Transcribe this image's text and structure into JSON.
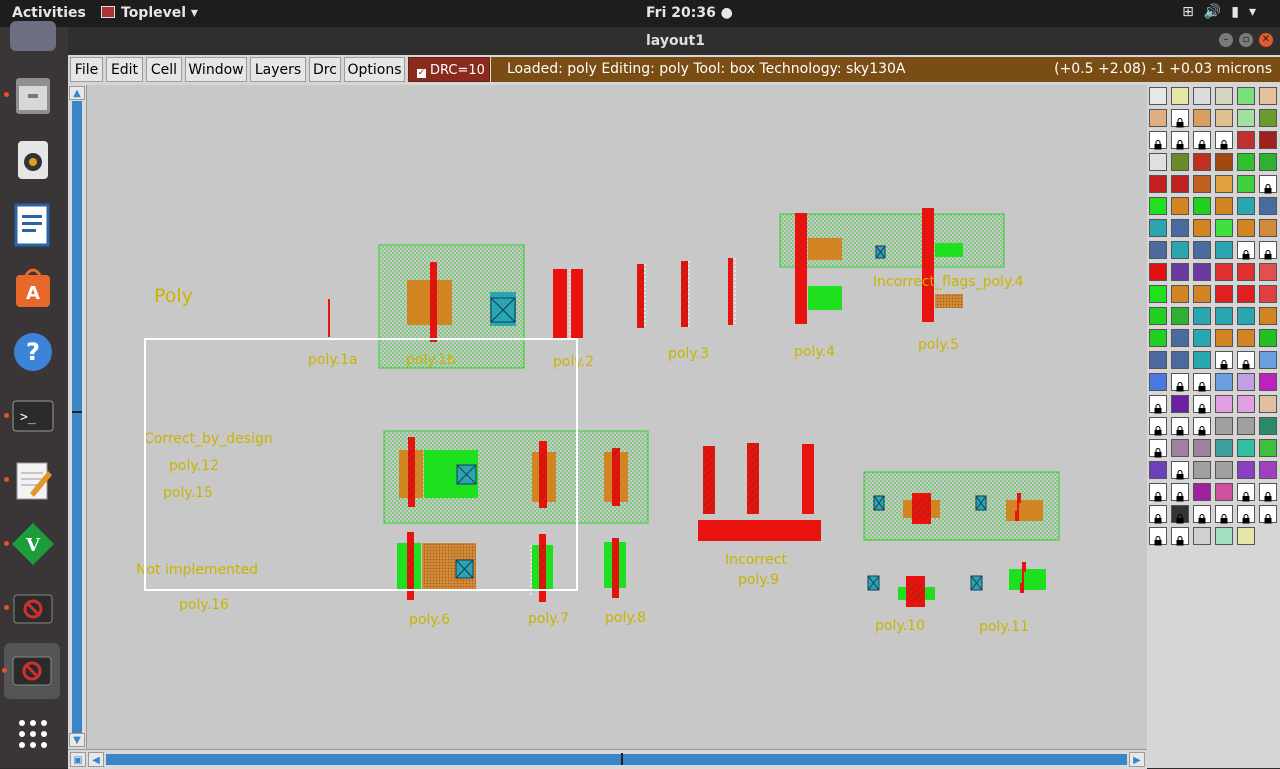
{
  "topbar": {
    "activities": "Activities",
    "app_name": "Toplevel",
    "clock": "Fri 20:36 ●"
  },
  "window": {
    "title": "layout1"
  },
  "menu": {
    "items": [
      "File",
      "Edit",
      "Cell",
      "Window",
      "Layers",
      "Drc",
      "Options"
    ],
    "drc_label": "DRC=10",
    "drc_checked": true
  },
  "status": {
    "loaded": "Loaded: poly Editing: poly Tool: box  Technology: sky130A",
    "coords": "(+0.5 +2.08) -1 +0.03 microns"
  },
  "dock": {
    "icons": [
      "mail-icon",
      "files-icon",
      "speaker-icon",
      "writer-icon",
      "software-center-icon",
      "help-icon",
      "terminal-icon",
      "text-editor-icon",
      "vim-icon",
      "app-forbidden-icon",
      "app-forbidden-icon-2",
      "show-apps-icon"
    ]
  },
  "layout": {
    "labels": {
      "poly_title": "Poly",
      "poly1a": "poly.1a",
      "poly1b": "poly.1b",
      "poly2": "poly.2",
      "poly3": "poly.3",
      "poly4": "poly.4",
      "poly5": "poly.5",
      "incorrect_flags": "Incorrect_flags_poly.4",
      "correct_by_design": "Correct_by_design",
      "poly12": "poly.12",
      "poly15": "poly.15",
      "not_implemented": "Not implemented",
      "poly16": "poly.16",
      "poly6": "poly.6",
      "poly7": "poly.7",
      "poly8": "poly.8",
      "incorrect": "Incorrect",
      "poly9": "poly.9",
      "poly10": "poly.10",
      "poly11": "poly.11"
    }
  },
  "colors": {
    "poly_red": "#e8120f",
    "diff_green": "#1ee01e",
    "nwell_dots": "#22cc22",
    "orange": "#d28422",
    "contact_teal": "#2aa6b0",
    "label_yellow": "#c8b400",
    "status_brown": "#7a4d14"
  }
}
